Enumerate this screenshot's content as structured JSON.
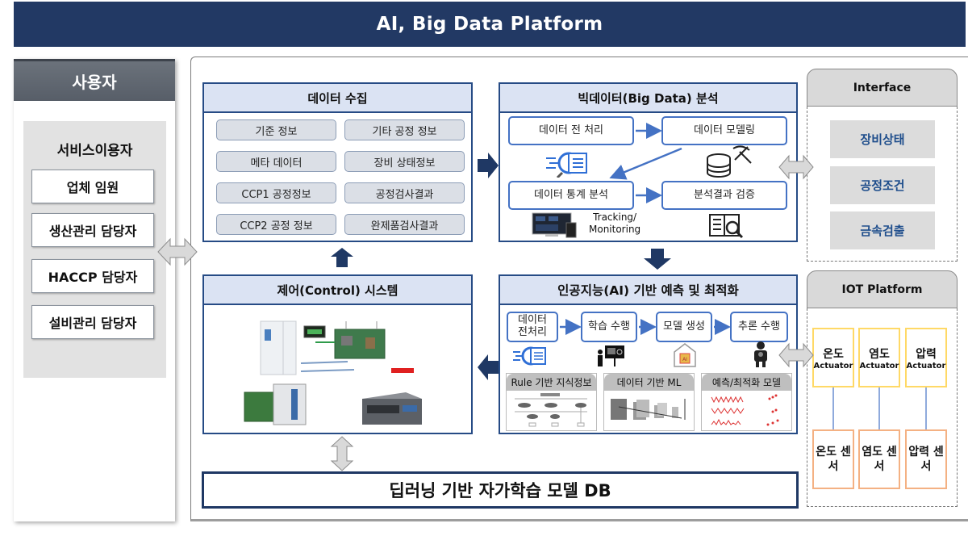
{
  "header": {
    "title": "AI, Big Data Platform"
  },
  "users": {
    "title": "사용자",
    "subtitle": "서비스이용자",
    "items": [
      {
        "label": "업체 임원"
      },
      {
        "label": "생산관리 담당자"
      },
      {
        "label": "HACCP 담당자"
      },
      {
        "label": "설비관리 담당자"
      }
    ]
  },
  "data_collection": {
    "title": "데이터 수집",
    "items": [
      {
        "label": "기준 정보"
      },
      {
        "label": "기타 공정 정보"
      },
      {
        "label": "메타 데이터"
      },
      {
        "label": "장비 상태정보"
      },
      {
        "label": "CCP1 공정정보"
      },
      {
        "label": "공정검사결과"
      },
      {
        "label": "CCP2 공정 정보"
      },
      {
        "label": "완제품검사결과"
      }
    ]
  },
  "big_data": {
    "title": "빅데이터(Big Data) 분석",
    "steps": [
      {
        "label": "데이터 전 처리"
      },
      {
        "label": "데이터 모델링"
      },
      {
        "label": "데이터 통계 분석"
      },
      {
        "label": "분석결과 검증"
      }
    ],
    "monitoring_label_1": "Tracking/",
    "monitoring_label_2": "Monitoring"
  },
  "interface": {
    "title": "Interface",
    "items": [
      {
        "label": "장비상태"
      },
      {
        "label": "공정조건"
      },
      {
        "label": "금속검출"
      }
    ]
  },
  "control": {
    "title": "제어(Control) 시스템"
  },
  "ai": {
    "title": "인공지능(AI) 기반 예측 및 최적화",
    "steps": [
      {
        "label": "데이터\n전처리"
      },
      {
        "label": "학습 수행"
      },
      {
        "label": "모델 생성"
      },
      {
        "label": "추론 수행"
      }
    ],
    "cards": [
      {
        "label": "Rule 기반 지식정보"
      },
      {
        "label": "데이터 기반 ML"
      },
      {
        "label": "예측/최적화 모델"
      }
    ]
  },
  "iot": {
    "title": "IOT Platform",
    "actuators": [
      {
        "name": "온도",
        "sub": "Actuator"
      },
      {
        "name": "염도",
        "sub": "Actuator"
      },
      {
        "name": "압력",
        "sub": "Actuator"
      }
    ],
    "sensors": [
      {
        "label": "온도 센서"
      },
      {
        "label": "염도 센서"
      },
      {
        "label": "압력 센서"
      }
    ]
  },
  "model_db": {
    "label": "딥러닝 기반 자가학습 모델 DB"
  },
  "colors": {
    "header_bg": "#223964",
    "section_border": "#264b85",
    "section_title_bg": "#dbe3f3",
    "flow_border": "#4472c4",
    "interface_text": "#1f4e8c",
    "actuator_border": "#ffd966",
    "sensor_border": "#f4b183"
  }
}
